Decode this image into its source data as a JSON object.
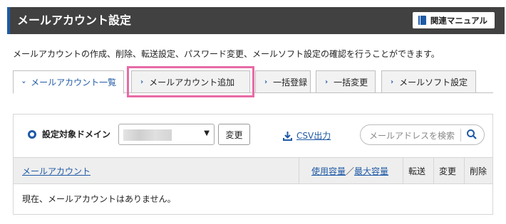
{
  "header": {
    "title": "メールアカウント設定",
    "manual_button": "関連マニュアル"
  },
  "description": "メールアカウントの作成、削除、転送設定、パスワード変更、メールソフト設定の確認を行うことができます。",
  "tabs": [
    {
      "label": "メールアカウント一覧",
      "active": true
    },
    {
      "label": "メールアカウント追加",
      "highlighted": true
    },
    {
      "label": "一括登録"
    },
    {
      "label": "一括変更"
    },
    {
      "label": "メールソフト設定"
    }
  ],
  "toolbar": {
    "domain_label": "設定対象ドメイン",
    "change_button": "変更",
    "csv_label": "CSV出力",
    "search_placeholder": "メールアドレスを検索"
  },
  "table": {
    "col_account": "メールアカウント",
    "col_usage": "使用容量",
    "col_separator": "／",
    "col_max": "最大容量",
    "col_forward": "転送",
    "col_change": "変更",
    "col_delete": "削除",
    "empty_message": "現在、メールアカウントはありません。"
  },
  "colors": {
    "accent": "#1f5aa6",
    "header_bg": "#414141",
    "highlight": "#e86aa6"
  }
}
